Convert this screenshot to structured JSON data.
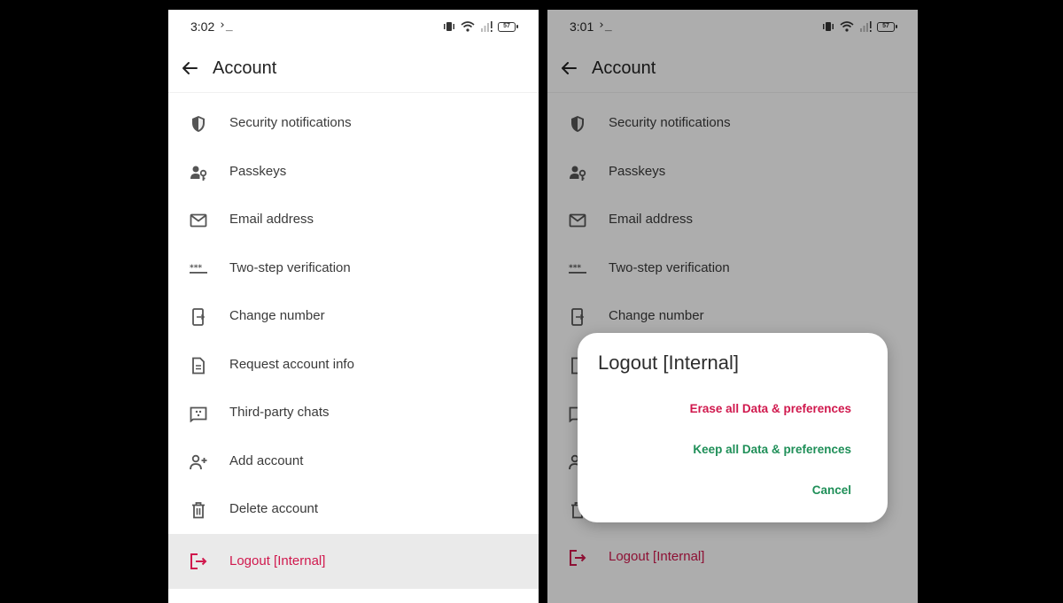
{
  "left_screen": {
    "status": {
      "time": "3:02",
      "terminal": "›_",
      "battery": "57"
    },
    "title": "Account",
    "menu": [
      {
        "label": "Security notifications",
        "icon": "shield-icon"
      },
      {
        "label": "Passkeys",
        "icon": "person-key-icon"
      },
      {
        "label": "Email address",
        "icon": "mail-icon"
      },
      {
        "label": "Two-step verification",
        "icon": "dots-icon"
      },
      {
        "label": "Change number",
        "icon": "phone-swap-icon"
      },
      {
        "label": "Request account info",
        "icon": "document-icon"
      },
      {
        "label": "Third-party chats",
        "icon": "chat-box-icon"
      },
      {
        "label": "Add account",
        "icon": "add-person-icon"
      },
      {
        "label": "Delete account",
        "icon": "trash-icon"
      },
      {
        "label": "Logout [Internal]",
        "icon": "logout-icon"
      }
    ]
  },
  "right_screen": {
    "status": {
      "time": "3:01",
      "terminal": "›_",
      "battery": "57"
    },
    "title": "Account",
    "menu": [
      {
        "label": "Security notifications",
        "icon": "shield-icon"
      },
      {
        "label": "Passkeys",
        "icon": "person-key-icon"
      },
      {
        "label": "Email address",
        "icon": "mail-icon"
      },
      {
        "label": "Two-step verification",
        "icon": "dots-icon"
      },
      {
        "label": "Change number",
        "icon": "phone-swap-icon"
      },
      {
        "label": "Logout [Internal]",
        "icon": "logout-icon"
      }
    ],
    "dialog": {
      "title": "Logout [Internal]",
      "erase_label": "Erase all Data & preferences",
      "keep_label": "Keep all Data & preferences",
      "cancel_label": "Cancel"
    }
  },
  "colors": {
    "destructive": "#d0184d",
    "positive": "#1f8f58",
    "icon": "#555555",
    "scrim": "rgba(0,0,0,0.32)"
  }
}
